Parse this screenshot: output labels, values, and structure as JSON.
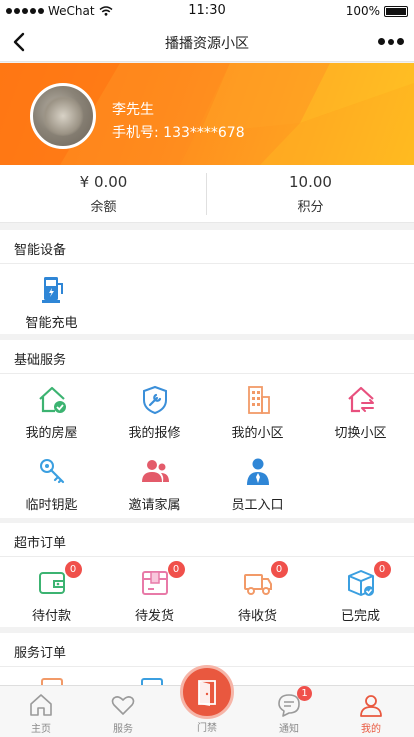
{
  "status_bar": {
    "carrier": "WeChat",
    "time": "11:30",
    "battery": "100%"
  },
  "nav": {
    "title": "播播资源小区"
  },
  "profile": {
    "name": "李先生",
    "phone": "手机号: 133****678"
  },
  "balance": {
    "amount": "¥ 0.00",
    "amount_label": "余额",
    "points": "10.00",
    "points_label": "积分"
  },
  "sections": {
    "smart": {
      "title": "智能设备",
      "items": [
        {
          "label": "智能充电",
          "icon": "charging-station-icon"
        }
      ]
    },
    "basic": {
      "title": "基础服务",
      "items": [
        {
          "label": "我的房屋",
          "icon": "house-check-icon",
          "color": "#3cb371"
        },
        {
          "label": "我的报修",
          "icon": "repair-shield-icon",
          "color": "#3b8fd9"
        },
        {
          "label": "我的小区",
          "icon": "building-icon",
          "color": "#f29a68"
        },
        {
          "label": "切换小区",
          "icon": "switch-house-icon",
          "color": "#e8507e"
        },
        {
          "label": "临时钥匙",
          "icon": "key-icon",
          "color": "#3b9fe0"
        },
        {
          "label": "邀请家属",
          "icon": "invite-family-icon",
          "color": "#e35b6a"
        },
        {
          "label": "员工入口",
          "icon": "staff-icon",
          "color": "#2f86d6"
        }
      ]
    },
    "market": {
      "title": "超市订单",
      "items": [
        {
          "label": "待付款",
          "badge": "0",
          "icon": "wallet-icon",
          "color": "#3cb371"
        },
        {
          "label": "待发货",
          "badge": "0",
          "icon": "package-icon",
          "color": "#e87aa8"
        },
        {
          "label": "待收货",
          "badge": "0",
          "icon": "truck-icon",
          "color": "#f29a68"
        },
        {
          "label": "已完成",
          "badge": "0",
          "icon": "box-done-icon",
          "color": "#3b9fe0"
        }
      ]
    },
    "service": {
      "title": "服务订单"
    }
  },
  "tabbar": {
    "items": [
      {
        "label": "主页",
        "icon": "home-icon"
      },
      {
        "label": "服务",
        "icon": "heart-icon"
      },
      {
        "label": "门禁",
        "icon": "door-icon"
      },
      {
        "label": "通知",
        "icon": "chat-icon",
        "badge": "1"
      },
      {
        "label": "我的",
        "icon": "user-icon",
        "active": true
      }
    ]
  },
  "colors": {
    "accent": "#e9583f",
    "banner_start": "#ff7a16",
    "banner_end": "#ffc01f",
    "badge": "#f0504b"
  }
}
